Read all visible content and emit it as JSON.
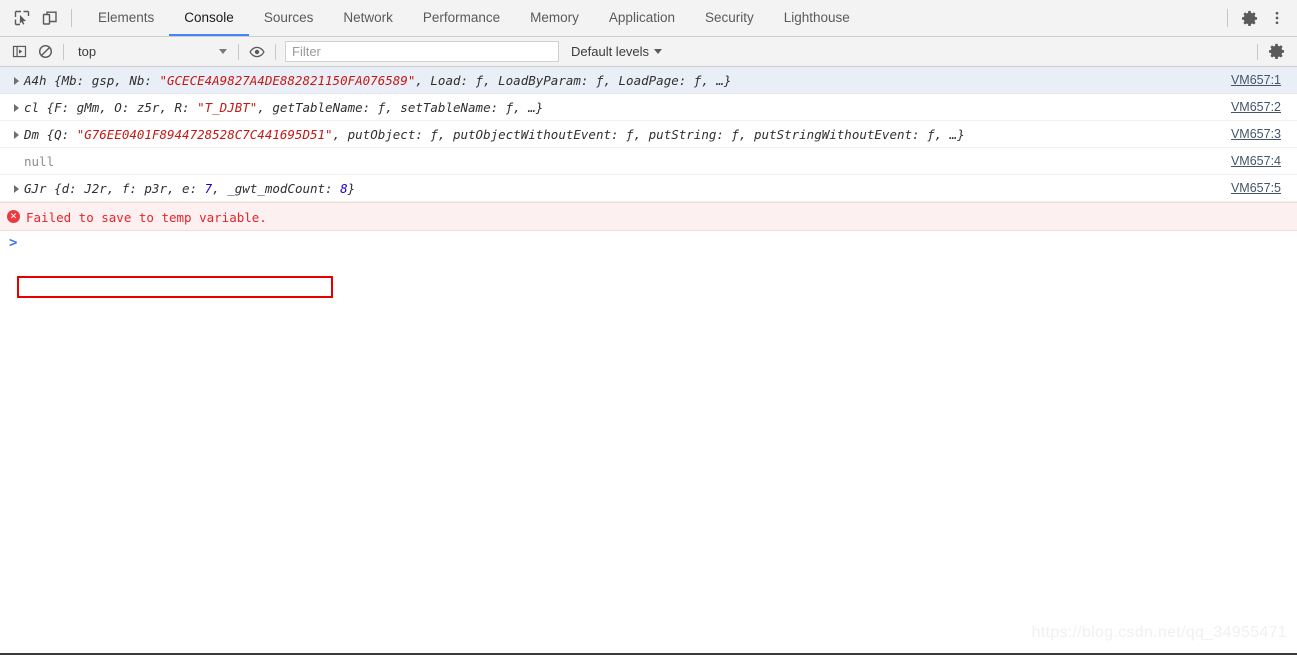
{
  "window": {
    "title": "Chrome DevTools - Console"
  },
  "toolbar": {
    "inspect_icon": "inspect-cursor-icon",
    "device_icon": "device-toolbar-icon",
    "settings_icon": "gear-icon",
    "more_icon": "more-vertical-icon",
    "tabs": [
      {
        "label": "Elements",
        "selected": false
      },
      {
        "label": "Console",
        "selected": true
      },
      {
        "label": "Sources",
        "selected": false
      },
      {
        "label": "Network",
        "selected": false
      },
      {
        "label": "Performance",
        "selected": false
      },
      {
        "label": "Memory",
        "selected": false
      },
      {
        "label": "Application",
        "selected": false
      },
      {
        "label": "Security",
        "selected": false
      },
      {
        "label": "Lighthouse",
        "selected": false
      }
    ]
  },
  "console_toolbar": {
    "sidebar_icon": "show-console-sidebar-icon",
    "clear_icon": "clear-console-icon",
    "context": "top",
    "eye_icon": "live-expression-eye-icon",
    "filter_placeholder": "Filter",
    "filter_value": "",
    "levels": "Default levels",
    "settings_icon": "console-settings-gear-icon"
  },
  "console": {
    "rows": [
      {
        "expandable": true,
        "kind": "object",
        "link": "VM657:1",
        "highlight": "first",
        "parts": [
          {
            "t": "A4h {Mb: gsp, Nb: ",
            "c": "plain"
          },
          {
            "t": "\"GCECE4A9827A4DE882821150FA076589\"",
            "c": "str"
          },
          {
            "t": ", Load: ƒ, LoadByParam: ƒ, LoadPage: ƒ, …}",
            "c": "plain"
          }
        ]
      },
      {
        "expandable": true,
        "kind": "object",
        "link": "VM657:2",
        "highlight": "none",
        "parts": [
          {
            "t": "cl {F: gMm, O: z5r, R: ",
            "c": "plain"
          },
          {
            "t": "\"T_DJBT\"",
            "c": "str"
          },
          {
            "t": ", getTableName: ƒ, setTableName: ƒ, …}",
            "c": "plain"
          }
        ]
      },
      {
        "expandable": true,
        "kind": "object",
        "link": "VM657:3",
        "highlight": "none",
        "parts": [
          {
            "t": "Dm {Q: ",
            "c": "plain"
          },
          {
            "t": "\"G76EE0401F8944728528C7C441695D51\"",
            "c": "str"
          },
          {
            "t": ", putObject: ƒ, putObjectWithoutEvent: ƒ, putString: ƒ, putStringWithoutEvent: ƒ, …}",
            "c": "plain"
          }
        ]
      },
      {
        "expandable": false,
        "kind": "null",
        "link": "VM657:4",
        "highlight": "none",
        "parts": [
          {
            "t": "null",
            "c": "nullv"
          }
        ]
      },
      {
        "expandable": true,
        "kind": "object",
        "link": "VM657:5",
        "highlight": "none",
        "parts": [
          {
            "t": "GJr {d: J2r, f: p3r, e: ",
            "c": "plain"
          },
          {
            "t": "7",
            "c": "num"
          },
          {
            "t": ", _gwt_modCount: ",
            "c": "plain"
          },
          {
            "t": "8",
            "c": "num"
          },
          {
            "t": "}",
            "c": "plain"
          }
        ]
      }
    ],
    "error": {
      "icon": "error-circle-icon",
      "icon_glyph": "✕",
      "text": "Failed to save to temp variable."
    },
    "prompt": ">"
  },
  "annotation": {
    "color": "#e60000",
    "target": "Failed to save to temp variable."
  },
  "watermark": {
    "text": "https://blog.csdn.net/qq_34955471"
  },
  "colors": {
    "accent": "#4285f4",
    "error": "#eb3941",
    "string": "#c41a16",
    "number": "#1c00cf",
    "link": "#44566b",
    "row_highlight": "#eaeff7",
    "error_row_bg": "#fdf0f0"
  }
}
